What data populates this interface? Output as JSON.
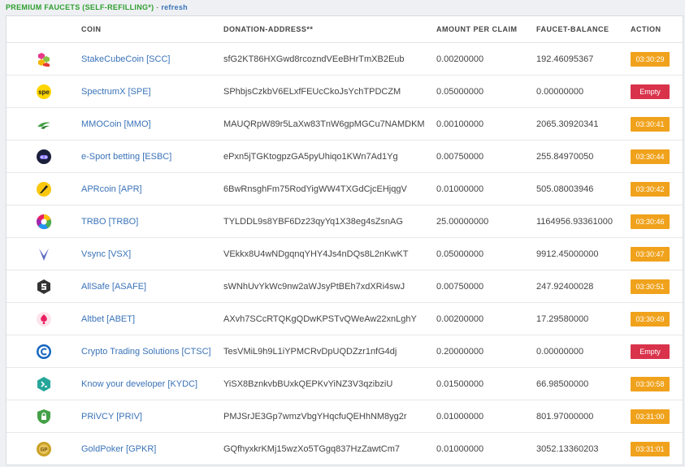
{
  "header": {
    "title": "PREMIUM FAUCETS (SELF-REFILLING*)",
    "separator": " - ",
    "refresh": "refresh"
  },
  "columns": {
    "coin": "COIN",
    "address": "DONATION-ADDRESS**",
    "amount": "AMOUNT PER CLAIM",
    "balance": "FAUCET-BALANCE",
    "action": "ACTION"
  },
  "rows": [
    {
      "icon": "stakecubecoin-icon",
      "coin": "StakeCubeCoin [SCC]",
      "address": "sfG2KT86HXGwd8rcozndVEeBHrTmXB2Eub",
      "amount": "0.00200000",
      "balance": "192.46095367",
      "action": "03:30:29",
      "status": "timer"
    },
    {
      "icon": "spectrumx-icon",
      "coin": "SpectrumX [SPE]",
      "address": "SPhbjsCzkbV6ELxfFEUcCkoJsYchTPDCZM",
      "amount": "0.05000000",
      "balance": "0.00000000",
      "action": "Empty",
      "status": "empty"
    },
    {
      "icon": "mmocoin-icon",
      "coin": "MMOCoin [MMO]",
      "address": "MAUQRpW89r5LaXw83TnW6gpMGCu7NAMDKM",
      "amount": "0.00100000",
      "balance": "2065.30920341",
      "action": "03:30:41",
      "status": "timer"
    },
    {
      "icon": "esport-betting-icon",
      "coin": "e-Sport betting [ESBC]",
      "address": "ePxn5jTGKtogpzGA5pyUhiqo1KWn7Ad1Yg",
      "amount": "0.00750000",
      "balance": "255.84970050",
      "action": "03:30:44",
      "status": "timer"
    },
    {
      "icon": "aprcoin-icon",
      "coin": "APRcoin [APR]",
      "address": "6BwRnsghFm75RodYigWW4TXGdCjcEHjqgV",
      "amount": "0.01000000",
      "balance": "505.08003946",
      "action": "03:30:42",
      "status": "timer"
    },
    {
      "icon": "trbo-icon",
      "coin": "TRBO [TRBO]",
      "address": "TYLDDL9s8YBF6Dz23qyYq1X38eg4sZsnAG",
      "amount": "25.00000000",
      "balance": "1164956.93361000",
      "action": "03:30:46",
      "status": "timer"
    },
    {
      "icon": "vsync-icon",
      "coin": "Vsync [VSX]",
      "address": "VEkkx8U4wNDgqnqYHY4Js4nDQs8L2nKwKT",
      "amount": "0.05000000",
      "balance": "9912.45000000",
      "action": "03:30:47",
      "status": "timer"
    },
    {
      "icon": "allsafe-icon",
      "coin": "AllSafe [ASAFE]",
      "address": "sWNhUvYkWc9nw2aWJsyPtBEh7xdXRi4swJ",
      "amount": "0.00750000",
      "balance": "247.92400028",
      "action": "03:30:51",
      "status": "timer"
    },
    {
      "icon": "altbet-icon",
      "coin": "Altbet [ABET]",
      "address": "AXvh7SCcRTQKgQDwKPSTvQWeAw22xnLghY",
      "amount": "0.00200000",
      "balance": "17.29580000",
      "action": "03:30:49",
      "status": "timer"
    },
    {
      "icon": "crypto-trading-solutions-icon",
      "coin": "Crypto Trading Solutions [CTSC]",
      "address": "TesVMiL9h9L1iYPMCRvDpUQDZzr1nfG4dj",
      "amount": "0.20000000",
      "balance": "0.00000000",
      "action": "Empty",
      "status": "empty"
    },
    {
      "icon": "know-your-developer-icon",
      "coin": "Know your developer [KYDC]",
      "address": "YiSX8BznkvbBUxkQEPKvYiNZ3V3qzibziU",
      "amount": "0.01500000",
      "balance": "66.98500000",
      "action": "03:30:58",
      "status": "timer"
    },
    {
      "icon": "privcy-icon",
      "coin": "PRiVCY [PRIV]",
      "address": "PMJSrJE3Gp7wmzVbgYHqcfuQEHhNM8yg2r",
      "amount": "0.01000000",
      "balance": "801.97000000",
      "action": "03:31:00",
      "status": "timer"
    },
    {
      "icon": "goldpoker-icon",
      "coin": "GoldPoker [GPKR]",
      "address": "GQfhyxkrKMj15wzXo5TGgq837HzZawtCm7",
      "amount": "0.01000000",
      "balance": "3052.13360203",
      "action": "03:31:01",
      "status": "timer"
    }
  ],
  "colors": {
    "title_green": "#2e9e2e",
    "link_blue": "#3a73b8",
    "timer_orange": "#f0a21c",
    "empty_red": "#d9334b"
  }
}
